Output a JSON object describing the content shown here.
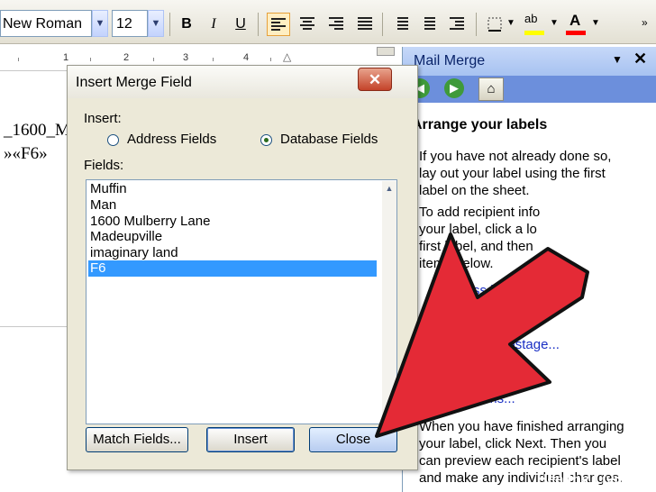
{
  "toolbar": {
    "font_name": "New Roman",
    "font_size": "12",
    "bold": "B",
    "italic": "I",
    "underline": "U",
    "highlight_glyph": "ab",
    "font_color_glyph": "A",
    "colors": {
      "highlight": "#ffff00",
      "font_color": "#ff0000"
    }
  },
  "ruler": {
    "numbers": [
      "1",
      "2",
      "3",
      "4"
    ]
  },
  "document": {
    "line1": "_1600_M",
    "line2": "»«F6»"
  },
  "task_pane": {
    "title": "Mail Merge",
    "dropdown_glyph": "▼",
    "close_glyph": "✕",
    "heading": "Arrange your labels",
    "paragraph1": [
      "If you have not already done so,",
      "lay out your label using the first",
      "label on the sheet."
    ],
    "paragraph2": [
      "To add recipient info",
      "your label, click a lo",
      "first label, and then",
      "items below."
    ],
    "links": [
      "Address block...",
      "Greeting line...",
      "Electronic postage...",
      "More items..."
    ],
    "paragraph3": [
      "When you have finished arranging",
      "your label, click Next. Then you",
      "can preview each recipient's label",
      "and make any individual changes."
    ]
  },
  "dialog": {
    "title": "Insert Merge Field",
    "close_glyph": "✕",
    "insert_label": "Insert:",
    "radio_address": "Address Fields",
    "radio_database": "Database Fields",
    "fields_label": "Fields:",
    "fields": [
      "Muffin",
      "Man",
      "1600 Mulberry Lane",
      "Madeupville",
      "imaginary land",
      "F6"
    ],
    "selected_field": "F6",
    "selected_radio": "Database Fields",
    "buttons": {
      "match_fields": "Match Fields...",
      "insert": "Insert",
      "close": "Close"
    }
  },
  "overlay": {
    "arrow_color": "#e42a36",
    "watermark": "Healthy Living"
  }
}
